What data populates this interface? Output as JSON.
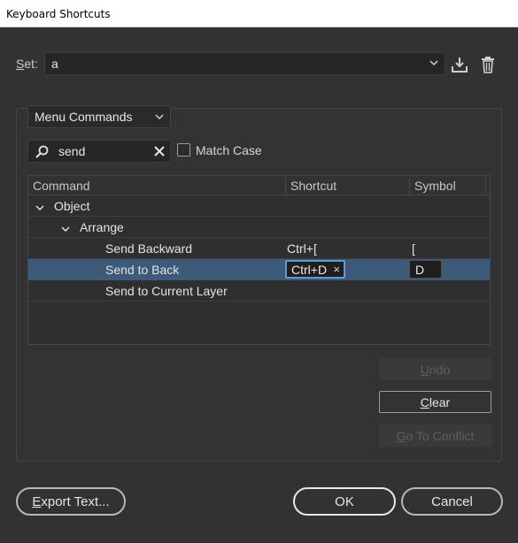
{
  "window": {
    "title": "Keyboard Shortcuts"
  },
  "set": {
    "label_accel": "S",
    "label_rest": "et:",
    "value": "a"
  },
  "menu_type": {
    "value": "Menu Commands"
  },
  "search": {
    "value": "send"
  },
  "match_case": {
    "label": "Match Case",
    "checked": false
  },
  "table": {
    "columns": [
      "Command",
      "Shortcut",
      "Symbol"
    ],
    "rows": [
      {
        "command": "Object"
      },
      {
        "command": "Arrange"
      },
      {
        "command": "Send Backward",
        "shortcut": "Ctrl+[",
        "symbol": "["
      },
      {
        "command": "Send to Back",
        "shortcut": "Ctrl+D",
        "clear_glyph": "×",
        "symbol": "D"
      },
      {
        "command": "Send to Current Layer"
      }
    ]
  },
  "buttons": {
    "undo_accel": "U",
    "undo_rest": "ndo",
    "clear_accel": "C",
    "clear_rest": "lear",
    "conflict_accel": "G",
    "conflict_rest": "o To Conflict",
    "export_accel": "E",
    "export_rest": "xport Text...",
    "ok": "OK",
    "cancel": "Cancel"
  },
  "colors": {
    "selected_row": "#3d5a78",
    "focus_border": "#5c9bd6"
  },
  "icons": [
    "chevron-down-icon",
    "download-icon",
    "trash-icon",
    "search-icon",
    "clear-icon",
    "caret-down-icon"
  ]
}
